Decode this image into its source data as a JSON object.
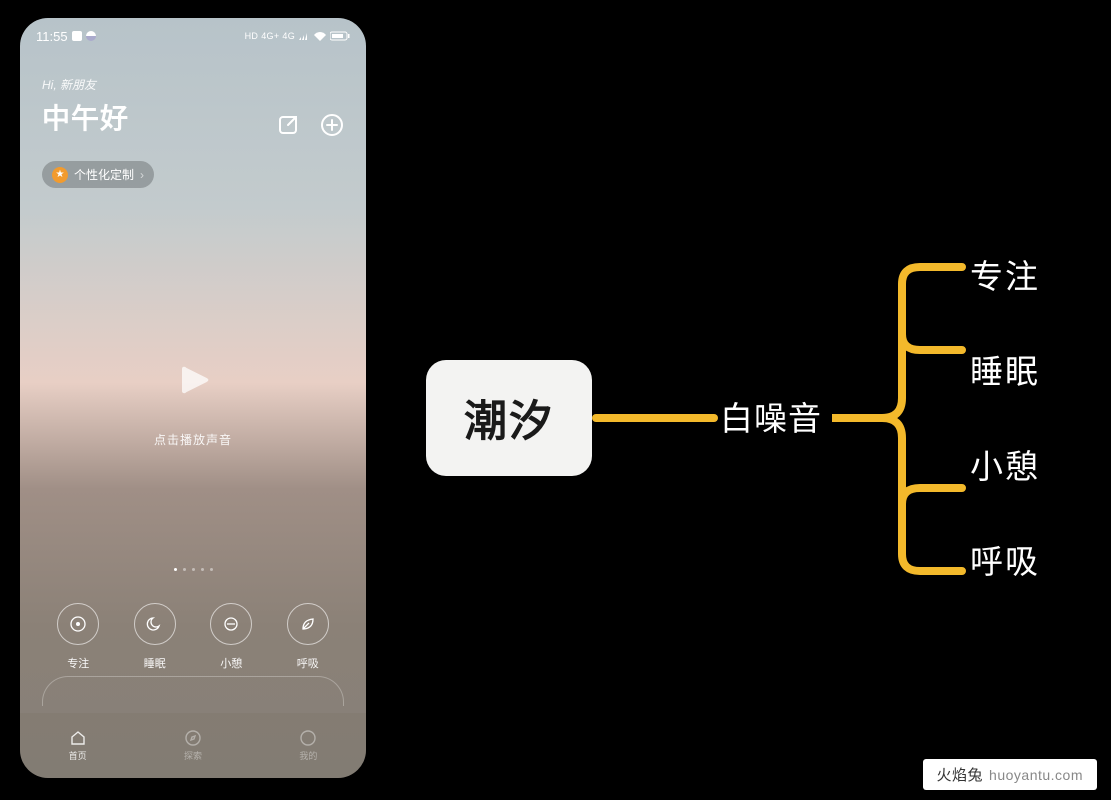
{
  "phone": {
    "status": {
      "time": "11:55"
    },
    "greeting_small_prefix": "Hi, ",
    "greeting_small_name": "新朋友",
    "greeting_large": "中午好",
    "customize_pill": "个性化定制",
    "play_label": "点击播放声音",
    "modes": [
      {
        "label": "专注"
      },
      {
        "label": "睡眠"
      },
      {
        "label": "小憩"
      },
      {
        "label": "呼吸"
      }
    ],
    "tabs": [
      {
        "label": "首页"
      },
      {
        "label": "探索"
      },
      {
        "label": "我的"
      }
    ]
  },
  "mindmap": {
    "root": "潮汐",
    "middle": "白噪音",
    "leaves": [
      "专注",
      "睡眠",
      "小憩",
      "呼吸"
    ]
  },
  "watermark": {
    "zh": "火焰兔",
    "en": "huoyantu.com"
  },
  "colors": {
    "accent": "#f3b92b"
  }
}
